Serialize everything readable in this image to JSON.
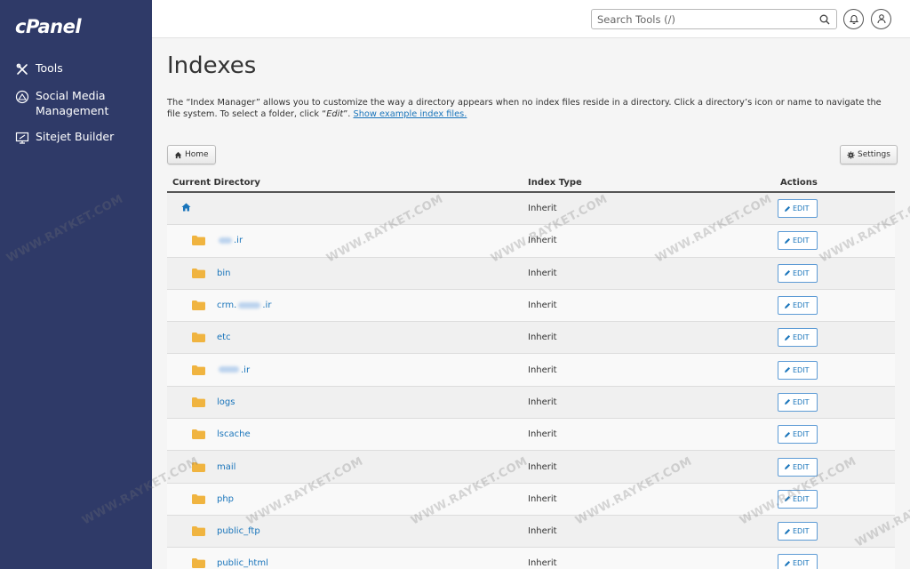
{
  "app": {
    "logo": "cPanel"
  },
  "sidebar": {
    "items": [
      {
        "label": "Tools",
        "icon": "tools-icon"
      },
      {
        "label": "Social Media Management",
        "icon": "social-media-icon"
      },
      {
        "label": "Sitejet Builder",
        "icon": "sitejet-icon"
      }
    ]
  },
  "header": {
    "search_placeholder": "Search Tools (/)"
  },
  "main": {
    "title": "Indexes",
    "description": "The “Index Manager” allows you to customize the way a directory appears when no index files reside in a directory. Click a directory’s icon or name to navigate the file system. To select a folder, click “",
    "description_edit": "Edit",
    "description_end": "”. ",
    "description_link": "Show example index files.",
    "home_button": "Home",
    "settings_button": "Settings",
    "table": {
      "headers": {
        "directory": "Current Directory",
        "index_type": "Index Type",
        "actions": "Actions"
      },
      "edit_label": "EDIT",
      "rows": [
        {
          "name": "",
          "prefix": "",
          "suffix": "",
          "type": "Inherit",
          "home": true
        },
        {
          "name": "",
          "prefix": "",
          "suffix": ".ir",
          "type": "Inherit",
          "blur": 30
        },
        {
          "name": "bin",
          "type": "Inherit"
        },
        {
          "name": "",
          "prefix": "crm.",
          "suffix": ".ir",
          "type": "Inherit",
          "blur": 50
        },
        {
          "name": "etc",
          "type": "Inherit"
        },
        {
          "name": "",
          "prefix": "",
          "suffix": ".ir",
          "type": "Inherit",
          "blur": 46
        },
        {
          "name": "logs",
          "type": "Inherit"
        },
        {
          "name": "lscache",
          "type": "Inherit"
        },
        {
          "name": "mail",
          "type": "Inherit"
        },
        {
          "name": "php",
          "type": "Inherit"
        },
        {
          "name": "public_ftp",
          "type": "Inherit"
        },
        {
          "name": "public_html",
          "type": "Inherit"
        }
      ]
    }
  },
  "watermark_text": "WWW.RAYKET.COM",
  "colors": {
    "sidebar": "#2f3a68",
    "link": "#1a75bb",
    "folder": "#f0b440"
  }
}
